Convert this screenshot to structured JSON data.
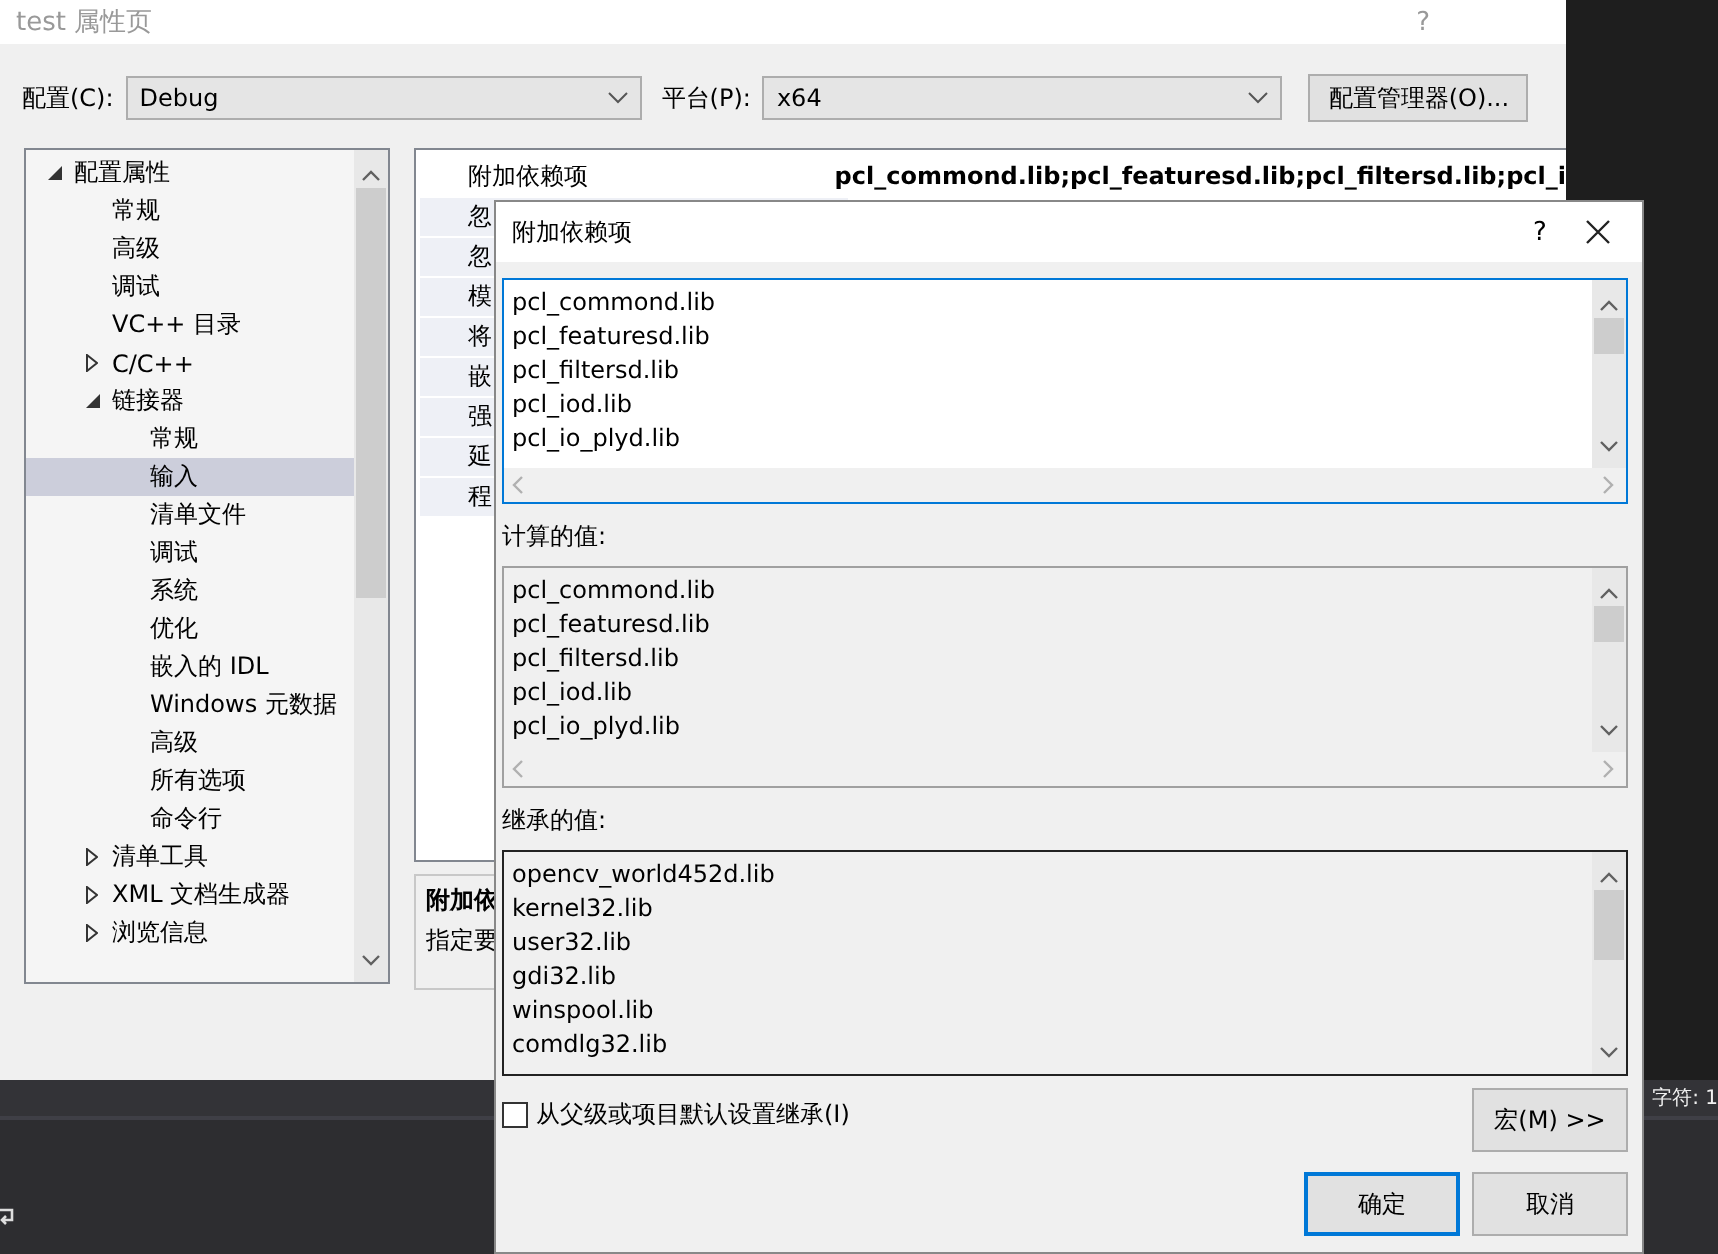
{
  "window": {
    "title": "test 属性页",
    "help": "?"
  },
  "config": {
    "label": "配置(C):",
    "value": "Debug"
  },
  "platform": {
    "label": "平台(P):",
    "value": "x64"
  },
  "manager_button": "配置管理器(O)...",
  "tree": [
    {
      "label": "配置属性",
      "expanded": true,
      "selected": false,
      "children": [
        {
          "label": "常规",
          "selected": false
        },
        {
          "label": "高级",
          "selected": false
        },
        {
          "label": "调试",
          "selected": false
        },
        {
          "label": "VC++ 目录",
          "selected": false
        },
        {
          "label": "C/C++",
          "expanded": false,
          "selected": false
        },
        {
          "label": "链接器",
          "expanded": true,
          "selected": false,
          "children": [
            {
              "label": "常规",
              "selected": false
            },
            {
              "label": "输入",
              "selected": true
            },
            {
              "label": "清单文件",
              "selected": false
            },
            {
              "label": "调试",
              "selected": false
            },
            {
              "label": "系统",
              "selected": false
            },
            {
              "label": "优化",
              "selected": false
            },
            {
              "label": "嵌入的 IDL",
              "selected": false
            },
            {
              "label": "Windows 元数据",
              "selected": false
            },
            {
              "label": "高级",
              "selected": false
            },
            {
              "label": "所有选项",
              "selected": false
            },
            {
              "label": "命令行",
              "selected": false
            }
          ]
        },
        {
          "label": "清单工具",
          "expanded": false,
          "selected": false
        },
        {
          "label": "XML 文档生成器",
          "expanded": false,
          "selected": false
        },
        {
          "label": "浏览信息",
          "expanded": false,
          "selected": false
        }
      ]
    }
  ],
  "properties": [
    {
      "name": "附加依赖项",
      "value": "pcl_commond.lib;pcl_featuresd.lib;pcl_filtersd.lib;pcl_i"
    },
    {
      "name": "忽"
    },
    {
      "name": "忽"
    },
    {
      "name": "模"
    },
    {
      "name": "将"
    },
    {
      "name": "嵌"
    },
    {
      "name": "强"
    },
    {
      "name": "延"
    },
    {
      "name": "程"
    }
  ],
  "description": {
    "title": "附加依",
    "text": "指定要"
  },
  "status_bar": {
    "text": "字符: 1"
  },
  "dialog": {
    "title": "附加依赖项",
    "help": "?",
    "edit_items": [
      "pcl_commond.lib",
      "pcl_featuresd.lib",
      "pcl_filtersd.lib",
      "pcl_iod.lib",
      "pcl_io_plyd.lib"
    ],
    "computed_label": "计算的值:",
    "computed_items": [
      "pcl_commond.lib",
      "pcl_featuresd.lib",
      "pcl_filtersd.lib",
      "pcl_iod.lib",
      "pcl_io_plyd.lib"
    ],
    "inherited_label": "继承的值:",
    "inherited_items": [
      "opencv_world452d.lib",
      "kernel32.lib",
      "user32.lib",
      "gdi32.lib",
      "winspool.lib",
      "comdlg32.lib"
    ],
    "inherit": {
      "label": "从父级或项目默认设置继承(I)",
      "checked": false
    },
    "macro_button": "宏(M) >>",
    "ok_button": "确定",
    "cancel_button": "取消"
  }
}
